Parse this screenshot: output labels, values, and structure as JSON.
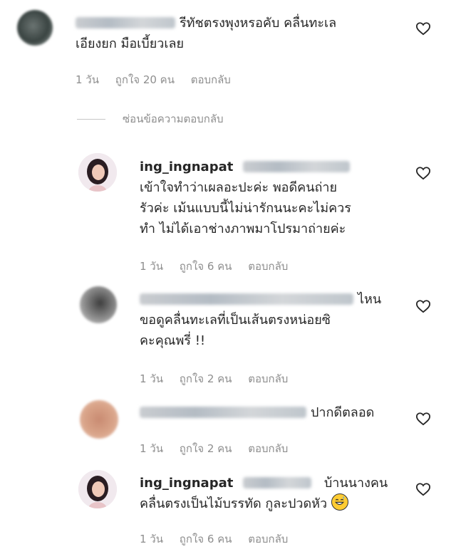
{
  "comments": [
    {
      "username": "",
      "text_line1": "รีทัชตรงพุงหรอคับ คลื่นทะเล",
      "text_line2": "เอียงยก มือเบี้ยวเลย",
      "time": "1 วัน",
      "likes": "ถูกใจ 20 คน",
      "reply": "ตอบกลับ"
    },
    {
      "username": "ing_ingnapat",
      "text_line1": "เข้าใจทำว่าเผลอะปะค่ะ พอดีคนถ่าย",
      "text_line2": "รัวค่ะ เม้นแบบนี้ไม่น่ารักนนะคะไม่ควร",
      "text_line3": "ทำ ไม่ได้เอาช่างภาพมาโปรมาถ่ายค่ะ",
      "time": "1 วัน",
      "likes": "ถูกใจ 6 คน",
      "reply": "ตอบกลับ"
    },
    {
      "username": "",
      "text_line1": "ไหน",
      "text_line2": "ขอดูคลื่นทะเลที่เป็นเส้นตรงหน่อยซิ",
      "text_line3": "คะคุณพรี่ !!",
      "time": "1 วัน",
      "likes": "ถูกใจ 2 คน",
      "reply": "ตอบกลับ"
    },
    {
      "username": "",
      "text_line1": "ปากดีตลอด",
      "time": "1 วัน",
      "likes": "ถูกใจ 2 คน",
      "reply": "ตอบกลับ"
    },
    {
      "username": "ing_ingnapat",
      "text_line1": "บ้านนางคน",
      "text_line2": "คลื่นตรงเป็นไม้บรรทัด กูละปวดหัว",
      "time": "1 วัน",
      "likes": "ถูกใจ 6 คน",
      "reply": "ตอบกลับ"
    }
  ],
  "hide_replies": "ซ่อนข้อความตอบกลับ",
  "icons": {
    "like": "heart-outline-icon",
    "emoji": "grinning-sweat-emoji"
  }
}
